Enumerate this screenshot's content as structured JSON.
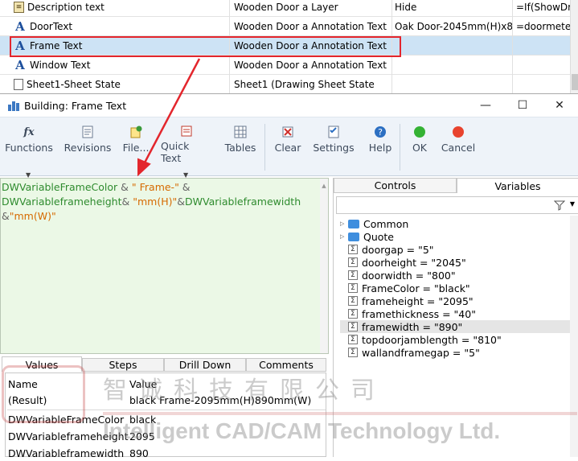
{
  "top_table": {
    "rows": [
      {
        "name": "Description text",
        "icon": "note-icon",
        "col2": "Wooden Door a Layer",
        "col3": "Hide",
        "col4": "=If(ShowDra",
        "selected": false
      },
      {
        "name": "DoorText",
        "icon": "text-a-icon",
        "col2": "Wooden Door a Annotation Text",
        "col3": "Oak Door-2045mm(H)x8",
        "col4": "=doormeter",
        "selected": false
      },
      {
        "name": "Frame Text",
        "icon": "text-a-icon",
        "col2": "Wooden Door a Annotation Text",
        "col3": "",
        "col4": "",
        "selected": true
      },
      {
        "name": "Window Text",
        "icon": "text-a-icon",
        "col2": "Wooden Door a Annotation Text",
        "col3": "",
        "col4": "",
        "selected": false
      },
      {
        "name": "Sheet1-Sheet State",
        "icon": "sheet-icon",
        "col2": "Sheet1 (Drawing Sheet State",
        "col3": "",
        "col4": "",
        "selected": false
      }
    ]
  },
  "dialog": {
    "title": "Building: Frame Text",
    "window_buttons": {
      "minimize": "—",
      "maximize": "☐",
      "close": "✕"
    }
  },
  "toolbar": {
    "functions": "Functions",
    "revisions": "Revisions",
    "file": "File...",
    "quick_text": "Quick Text",
    "tables": "Tables",
    "clear": "Clear",
    "settings": "Settings",
    "help": "Help",
    "ok": "OK",
    "cancel": "Cancel"
  },
  "editor": {
    "line1_var1": "DWVariableFrameColor",
    "line1_op1": " & ",
    "line1_str1": "\" Frame-\"",
    "line1_op2": " &",
    "line2_var1": "DWVariableframeheight",
    "line2_op1": "& ",
    "line2_str1": "\"mm(H)\"",
    "line2_op2": "&",
    "line2_var2": "DWVariableframewidth",
    "line3_op1": "&",
    "line3_str1": "\"mm(W)\""
  },
  "right_panel": {
    "tabs": [
      "Controls",
      "Variables"
    ],
    "active_tab": "Variables",
    "tree": [
      {
        "type": "folder",
        "label": "Common"
      },
      {
        "type": "folder",
        "label": "Quote"
      },
      {
        "type": "var",
        "label": "doorgap = \"5\""
      },
      {
        "type": "var",
        "label": "doorheight = \"2045\""
      },
      {
        "type": "var",
        "label": "doorwidth = \"800\""
      },
      {
        "type": "var",
        "label": "FrameColor = \"black\""
      },
      {
        "type": "var",
        "label": "frameheight = \"2095\""
      },
      {
        "type": "var",
        "label": "framethickness = \"40\""
      },
      {
        "type": "var",
        "label": "framewidth = \"890\"",
        "selected": true
      },
      {
        "type": "var",
        "label": "topdoorjamblength = \"810\""
      },
      {
        "type": "var",
        "label": "wallandframegap = \"5\""
      }
    ]
  },
  "bottom_tabs": [
    "Values",
    "Steps",
    "Drill Down",
    "Comments"
  ],
  "active_bottom_tab": "Values",
  "values_table": {
    "header": {
      "name": "Name",
      "value": "Value"
    },
    "rows": [
      {
        "name": "(Result)",
        "value": "black Frame-2095mm(H)890mm(W)"
      },
      {
        "name": "DWVariableFrameColor",
        "value": "black"
      },
      {
        "name": "DWVariableframeheight",
        "value": "2095"
      },
      {
        "name": "DWVariableframewidth",
        "value": "890"
      }
    ]
  },
  "watermark": {
    "chinese": "智诚科技有限公司",
    "english": "Intelligent CAD/CAM Technology Ltd."
  },
  "colors": {
    "highlight_red": "#e3262d",
    "editor_bg": "#ebf8e6",
    "variable_green": "#2e8b2e",
    "string_orange": "#d66a00",
    "selection_blue": "#cde3f5"
  }
}
